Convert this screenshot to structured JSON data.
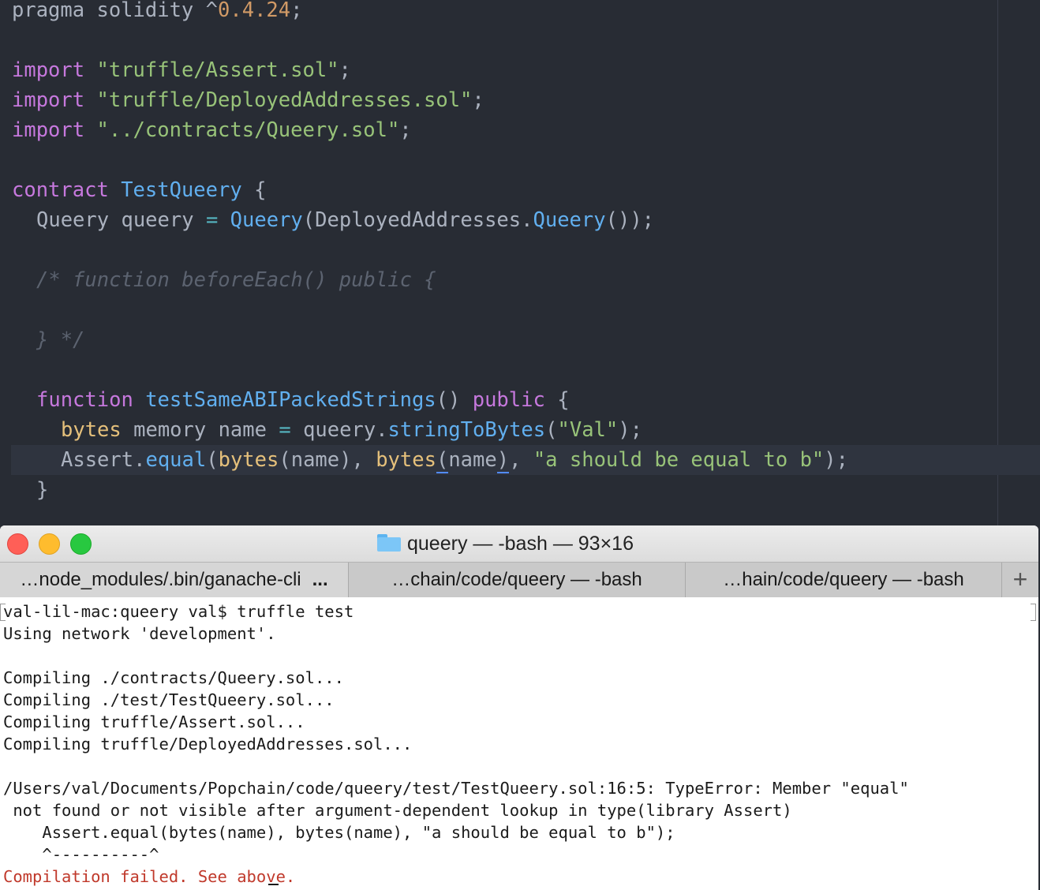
{
  "editor": {
    "line_pragma_kw": "pragma solidity",
    "line_pragma_caret": " ^",
    "line_pragma_ver": "0.4.24",
    "line_pragma_semi": ";",
    "import_kw": "import",
    "import_1": "\"truffle/Assert.sol\"",
    "import_2": "\"truffle/DeployedAddresses.sol\"",
    "import_3": "\"../contracts/Queery.sol\"",
    "semi": ";",
    "contract_kw": "contract",
    "contract_name": "TestQueery",
    "brace_open": " {",
    "brace_close": "}",
    "queery_decl_type": "Queery queery ",
    "eq": "=",
    "queery_ctor": "Queery",
    "queery_args_open": "(DeployedAddresses.",
    "queery_fn": "Queery",
    "queery_args_close": "());",
    "comment_1": "/* function beforeEach() public {",
    "comment_2": "} */",
    "function_kw": "function",
    "function_name": "testSameABIPackedStrings",
    "function_parens": "() ",
    "public_kw": "public",
    "bytes_kw": "bytes",
    "memory_name": " memory name ",
    "queery_obj": "queery.",
    "string_to_bytes": "stringToBytes",
    "val_open": "(",
    "val_str": "\"Val\"",
    "val_close": ");",
    "assert_obj": "Assert.",
    "equal_fn": "equal",
    "paren_open": "(",
    "name_paren": "(name), ",
    "name_arg": "name",
    "paren_close": ")",
    "comma": ", ",
    "msg_str": "\"a should be equal to b\"",
    "end_call": ");"
  },
  "terminal": {
    "title": "queery — -bash — 93×16",
    "tabs": [
      {
        "label": "…node_modules/.bin/ganache-cli",
        "suffix": "..."
      },
      {
        "label": "…chain/code/queery — -bash"
      },
      {
        "label": "…hain/code/queery — -bash"
      }
    ],
    "add_tab": "+",
    "lines": [
      "val-lil-mac:queery val$ truffle test",
      "Using network 'development'.",
      "",
      "Compiling ./contracts/Queery.sol...",
      "Compiling ./test/TestQueery.sol...",
      "Compiling truffle/Assert.sol...",
      "Compiling truffle/DeployedAddresses.sol...",
      "",
      "/Users/val/Documents/Popchain/code/queery/test/TestQueery.sol:16:5: TypeError: Member \"equal\"",
      " not found or not visible after argument-dependent lookup in type(library Assert)",
      "    Assert.equal(bytes(name), bytes(name), \"a should be equal to b\");",
      "    ^----------^"
    ],
    "error_line": "Compilation failed. See above."
  },
  "colors": {
    "editor_bg": "#282c34",
    "keyword": "#c678dd",
    "string": "#98c379",
    "function": "#61afef",
    "type": "#e5c07b",
    "number": "#d19a66",
    "error": "#c0392b"
  }
}
